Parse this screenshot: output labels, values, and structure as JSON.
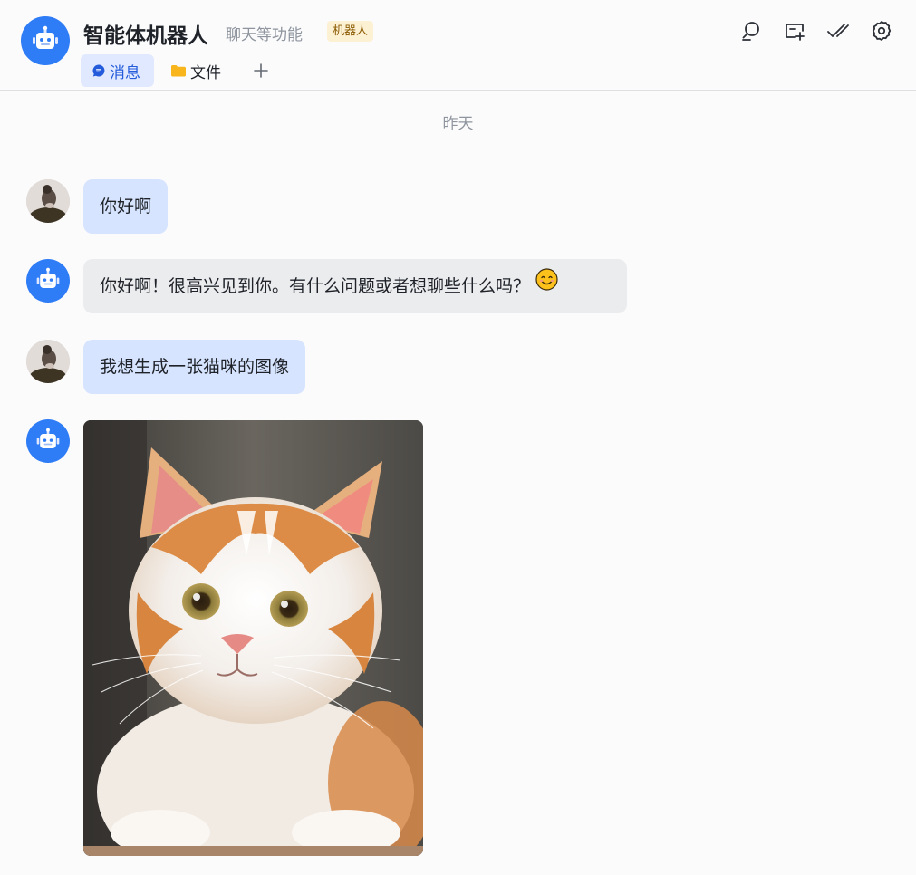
{
  "header": {
    "title": "智能体机器人",
    "subtitle": "聊天等功能",
    "badge": "机器人",
    "avatar_icon": "robot-icon",
    "tabs": [
      {
        "label": "消息",
        "icon": "chat-bubble-icon",
        "active": true
      },
      {
        "label": "文件",
        "icon": "folder-icon",
        "active": false
      }
    ],
    "add_tab_icon": "plus-icon",
    "toolbar_icons": [
      "search-icon",
      "add-window-icon",
      "check-all-icon",
      "gear-icon"
    ]
  },
  "chat": {
    "date_separator": "昨天",
    "messages": [
      {
        "sender": "user",
        "type": "text",
        "text": "你好啊"
      },
      {
        "sender": "bot",
        "type": "text",
        "text": "你好啊！很高兴见到你。有什么问题或者想聊些什么吗？",
        "emoji": "smiling-face-icon"
      },
      {
        "sender": "user",
        "type": "text",
        "text": "我想生成一张猫咪的图像"
      },
      {
        "sender": "bot",
        "type": "image",
        "image": "kitten-image"
      }
    ]
  },
  "colors": {
    "accent": "#2e7cf6",
    "user_bubble": "#d6e4ff",
    "bot_bubble": "#ebecee",
    "active_tab": "#e0e9ff",
    "badge_bg": "#fdf1d4"
  }
}
